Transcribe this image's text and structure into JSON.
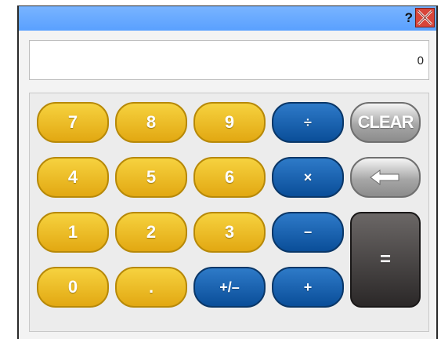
{
  "window": {
    "help_label": "?",
    "close_icon": "close-icon"
  },
  "display": {
    "value": "0"
  },
  "keys": {
    "row1": [
      "7",
      "8",
      "9",
      "÷",
      "CLEAR"
    ],
    "row2": [
      "4",
      "5",
      "6",
      "×",
      "backspace"
    ],
    "row3": [
      "1",
      "2",
      "3",
      "−"
    ],
    "row4": [
      "0",
      ".",
      "+/–",
      "+"
    ],
    "equals": "="
  },
  "colors": {
    "titlebar": "#5aa0ff",
    "digit_key": "#f0c022",
    "operator_key": "#1a5ea8",
    "utility_key": "#9a9a9a",
    "equals_key": "#3a3636",
    "close_button": "#d8453a"
  }
}
